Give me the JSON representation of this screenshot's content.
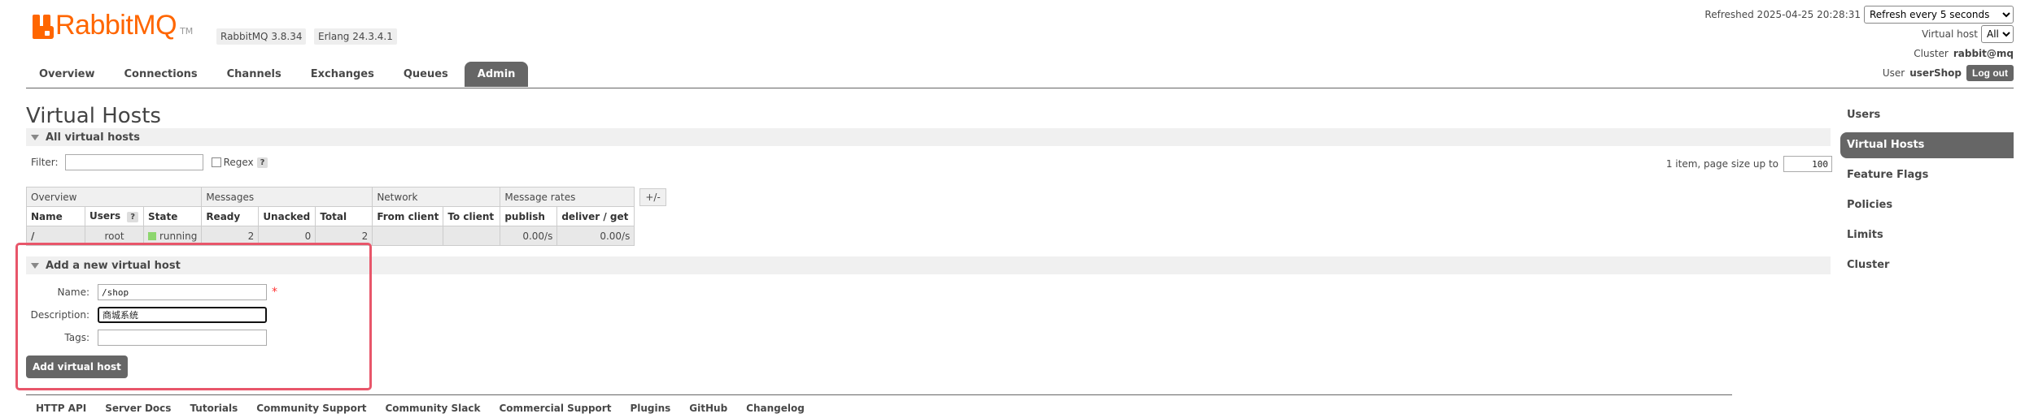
{
  "app": {
    "logo_text": "RabbitMQ",
    "logo_tm": "TM",
    "version_rabbitmq": "RabbitMQ 3.8.34",
    "version_erlang": "Erlang 24.3.4.1"
  },
  "header": {
    "refreshed": "Refreshed 2025-04-25 20:28:31",
    "refresh_select": "Refresh every 5 seconds",
    "vhost_label": "Virtual host",
    "vhost_select": "All",
    "cluster_label": "Cluster",
    "cluster_value": "rabbit@mq",
    "user_label": "User",
    "user_value": "userShop",
    "logout_label": "Log out"
  },
  "tabs": [
    "Overview",
    "Connections",
    "Channels",
    "Exchanges",
    "Queues",
    "Admin"
  ],
  "active_tab": "Admin",
  "main": {
    "title": "Virtual Hosts",
    "section_all": "All virtual hosts",
    "filter_label": "Filter:",
    "filter_value": "",
    "regex_label": "Regex",
    "help_mark": "?",
    "page_info": "1 item, page size up to",
    "page_size": "100"
  },
  "table": {
    "group_headers": [
      "Overview",
      "Messages",
      "Network",
      "Message rates"
    ],
    "plus_minus": "+/-",
    "columns": [
      "Name",
      "Users",
      "State",
      "Ready",
      "Unacked",
      "Total",
      "From client",
      "To client",
      "publish",
      "deliver / get"
    ],
    "rows": [
      {
        "name": "/",
        "users": "root",
        "state": "running",
        "ready": "2",
        "unacked": "0",
        "total": "2",
        "from_client": "",
        "to_client": "",
        "publish": "0.00/s",
        "deliver_get": "0.00/s"
      }
    ]
  },
  "form": {
    "section_title": "Add a new virtual host",
    "name_label": "Name:",
    "name_value": "/shop",
    "required_mark": "*",
    "description_label": "Description:",
    "description_value": "商城系统",
    "tags_label": "Tags:",
    "tags_value": "",
    "submit_label": "Add virtual host"
  },
  "footer": [
    "HTTP API",
    "Server Docs",
    "Tutorials",
    "Community Support",
    "Community Slack",
    "Commercial Support",
    "Plugins",
    "GitHub",
    "Changelog"
  ],
  "sidebar": [
    "Users",
    "Virtual Hosts",
    "Feature Flags",
    "Policies",
    "Limits",
    "Cluster"
  ],
  "sidebar_active": "Virtual Hosts",
  "colors": {
    "brand": "#ff6600",
    "active_tab": "#666666",
    "running": "#8dd66e",
    "highlight": "#e8566a"
  }
}
